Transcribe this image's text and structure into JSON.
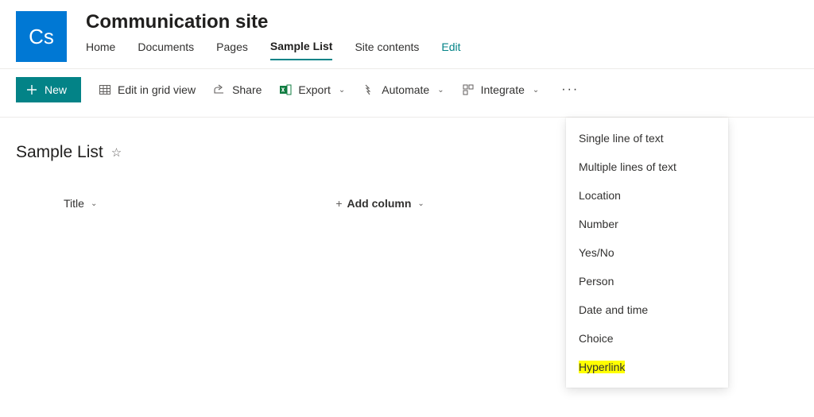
{
  "site": {
    "logo_text": "Cs",
    "title": "Communication site"
  },
  "nav": {
    "items": [
      {
        "label": "Home"
      },
      {
        "label": "Documents"
      },
      {
        "label": "Pages"
      },
      {
        "label": "Sample List",
        "active": true
      },
      {
        "label": "Site contents"
      }
    ],
    "edit": "Edit"
  },
  "cmdbar": {
    "new_label": "New",
    "grid_label": "Edit in grid view",
    "share_label": "Share",
    "export_label": "Export",
    "automate_label": "Automate",
    "integrate_label": "Integrate"
  },
  "list": {
    "title": "Sample List",
    "columns": {
      "title": "Title",
      "add": "Add column"
    }
  },
  "add_column_menu": {
    "items": [
      "Single line of text",
      "Multiple lines of text",
      "Location",
      "Number",
      "Yes/No",
      "Person",
      "Date and time",
      "Choice",
      "Hyperlink"
    ],
    "highlight_index": 8
  }
}
